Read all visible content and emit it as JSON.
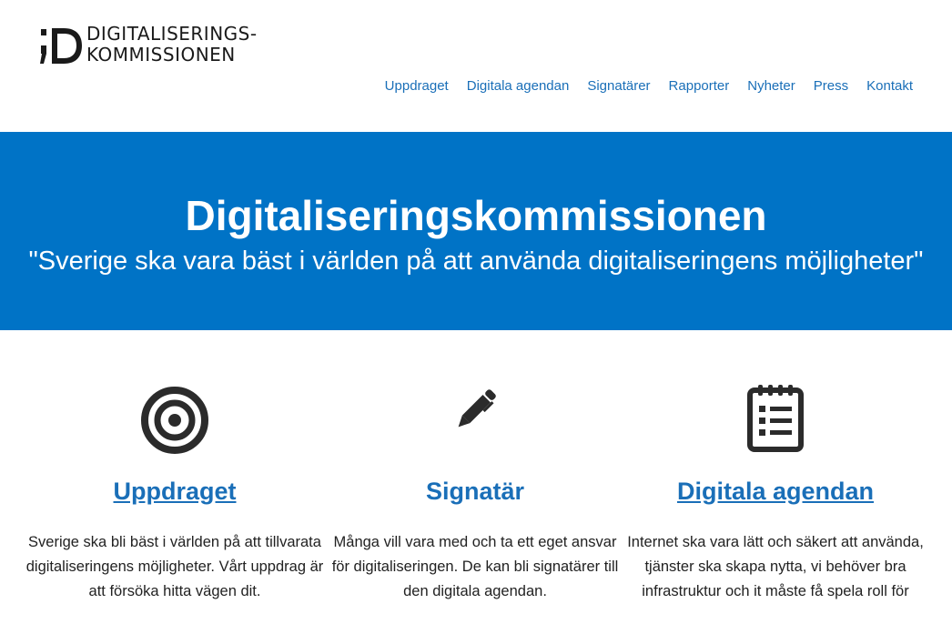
{
  "logo": {
    "line1": "DIGITALISERINGS-",
    "line2": "KOMMISSIONEN",
    "mark_icon": "semicolon-d-logo-mark"
  },
  "nav": {
    "items": [
      {
        "label": "Uppdraget"
      },
      {
        "label": "Digitala agendan"
      },
      {
        "label": "Signatärer"
      },
      {
        "label": "Rapporter"
      },
      {
        "label": "Nyheter"
      },
      {
        "label": "Press"
      },
      {
        "label": "Kontakt"
      }
    ]
  },
  "hero": {
    "title": "Digitaliseringskommissionen",
    "subtitle": "\"Sverige ska vara bäst i världen på att använda digitaliseringens möjligheter\""
  },
  "features": [
    {
      "icon": "target-icon",
      "title": "Uppdraget",
      "text": "Sverige ska bli bäst i världen på att tillvarata digitaliseringens möjligheter. Vårt uppdrag är att försöka hitta vägen dit."
    },
    {
      "icon": "pen-icon",
      "title": "Signatär",
      "text": "Många vill vara med och ta ett eget ansvar för digitaliseringen. De kan bli signatärer till den digitala agendan."
    },
    {
      "icon": "checklist-notepad-icon",
      "title": "Digitala agendan",
      "text": "Internet ska vara lätt och säkert att använda, tjänster ska skapa nytta, vi behöver bra infrastruktur och it måste få spela roll för"
    }
  ],
  "colors": {
    "brand_blue": "#0073c6",
    "link_blue": "#1a6fb8",
    "icon_dark": "#2b2b2b"
  }
}
